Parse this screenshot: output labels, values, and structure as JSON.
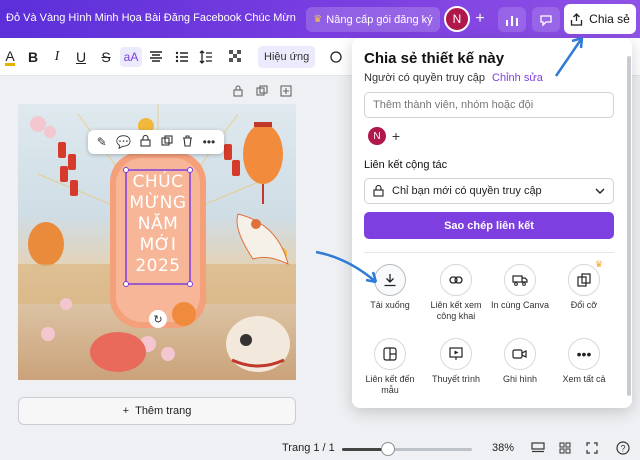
{
  "topbar": {
    "title": "Đỏ Và Vàng Hình Minh Họa Bài Đăng Facebook Chúc Mừng ...",
    "upgrade_label": "Nâng cấp gói đăng ký",
    "avatar_letter": "N",
    "share_label": "Chia sẻ"
  },
  "toolbar": {
    "effects_label": "Hiệu ứng",
    "text_case": "aA"
  },
  "design": {
    "headline_lines": [
      "CHÚC",
      "MỪNG",
      "NĂM",
      "MỚI",
      "2025"
    ]
  },
  "canvas": {
    "add_page_label": "Thêm trang"
  },
  "share_panel": {
    "title": "Chia sẻ thiết kế này",
    "access_label": "Người có quyền truy cập",
    "edit_link": "Chỉnh sửa",
    "search_placeholder": "Thêm thành viên, nhóm hoặc đội",
    "avatar_letter": "N",
    "collab_link_label": "Liên kết cộng tác",
    "access_option": "Chỉ bạn mới có quyền truy cập",
    "copy_link_label": "Sao chép liên kết",
    "options": [
      {
        "label": "Tải xuống",
        "icon": "download-icon"
      },
      {
        "label": "Liên kết xem công khai",
        "icon": "link-icon"
      },
      {
        "label": "In cùng Canva",
        "icon": "truck-icon"
      },
      {
        "label": "Đổi cỡ",
        "icon": "resize-icon"
      },
      {
        "label": "Liên kết đến mẫu",
        "icon": "template-icon"
      },
      {
        "label": "Thuyết trình",
        "icon": "present-icon"
      },
      {
        "label": "Ghi hình",
        "icon": "record-icon"
      },
      {
        "label": "Xem tất cả",
        "icon": "more-icon"
      }
    ]
  },
  "footer": {
    "page_indicator": "Trang 1 / 1",
    "zoom_label": "38%",
    "zoom_value": 38
  },
  "colors": {
    "accent": "#7d3fe0",
    "avatar": "#b0174b",
    "annotation_arrow": "#2f7bd6"
  }
}
